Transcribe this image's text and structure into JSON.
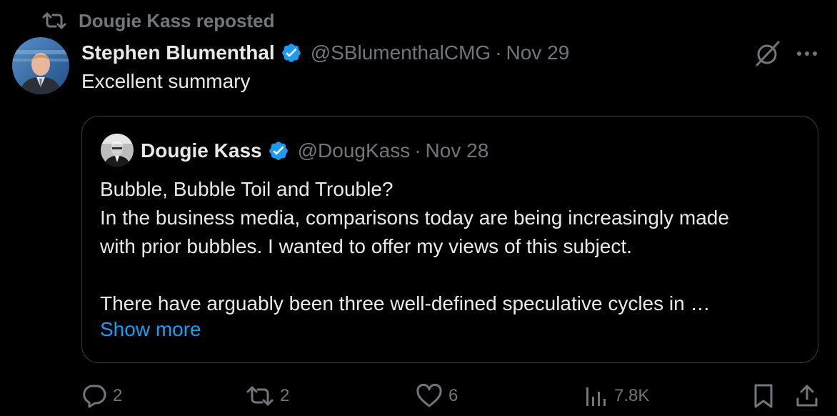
{
  "repost": {
    "icon": "repost-icon",
    "text": "Dougie Kass reposted"
  },
  "tweet": {
    "author_name": "Stephen Blumenthal",
    "handle": "@SBlumenthalCMG",
    "separator": "·",
    "date": "Nov 29",
    "text": "Excellent summary",
    "verified_color": "#1d9bf0"
  },
  "quote": {
    "author_name": "Dougie Kass",
    "handle": "@DougKass",
    "separator": "·",
    "date": "Nov 28",
    "lines": [
      "Bubble, Bubble Toil and Trouble?",
      "In the business media, comparisons today are being increasingly made",
      "with prior bubbles. I wanted to offer my views of this subject.",
      "There have arguably been three well-defined speculative cycles in …"
    ],
    "show_more": "Show more"
  },
  "actions": {
    "replies": "2",
    "reposts": "2",
    "likes": "6",
    "views": "7.8K"
  },
  "colors": {
    "background": "#000000",
    "text_primary": "#e7e9ea",
    "text_secondary": "#71767b",
    "accent": "#1d9bf0",
    "border": "#3a3d41"
  }
}
